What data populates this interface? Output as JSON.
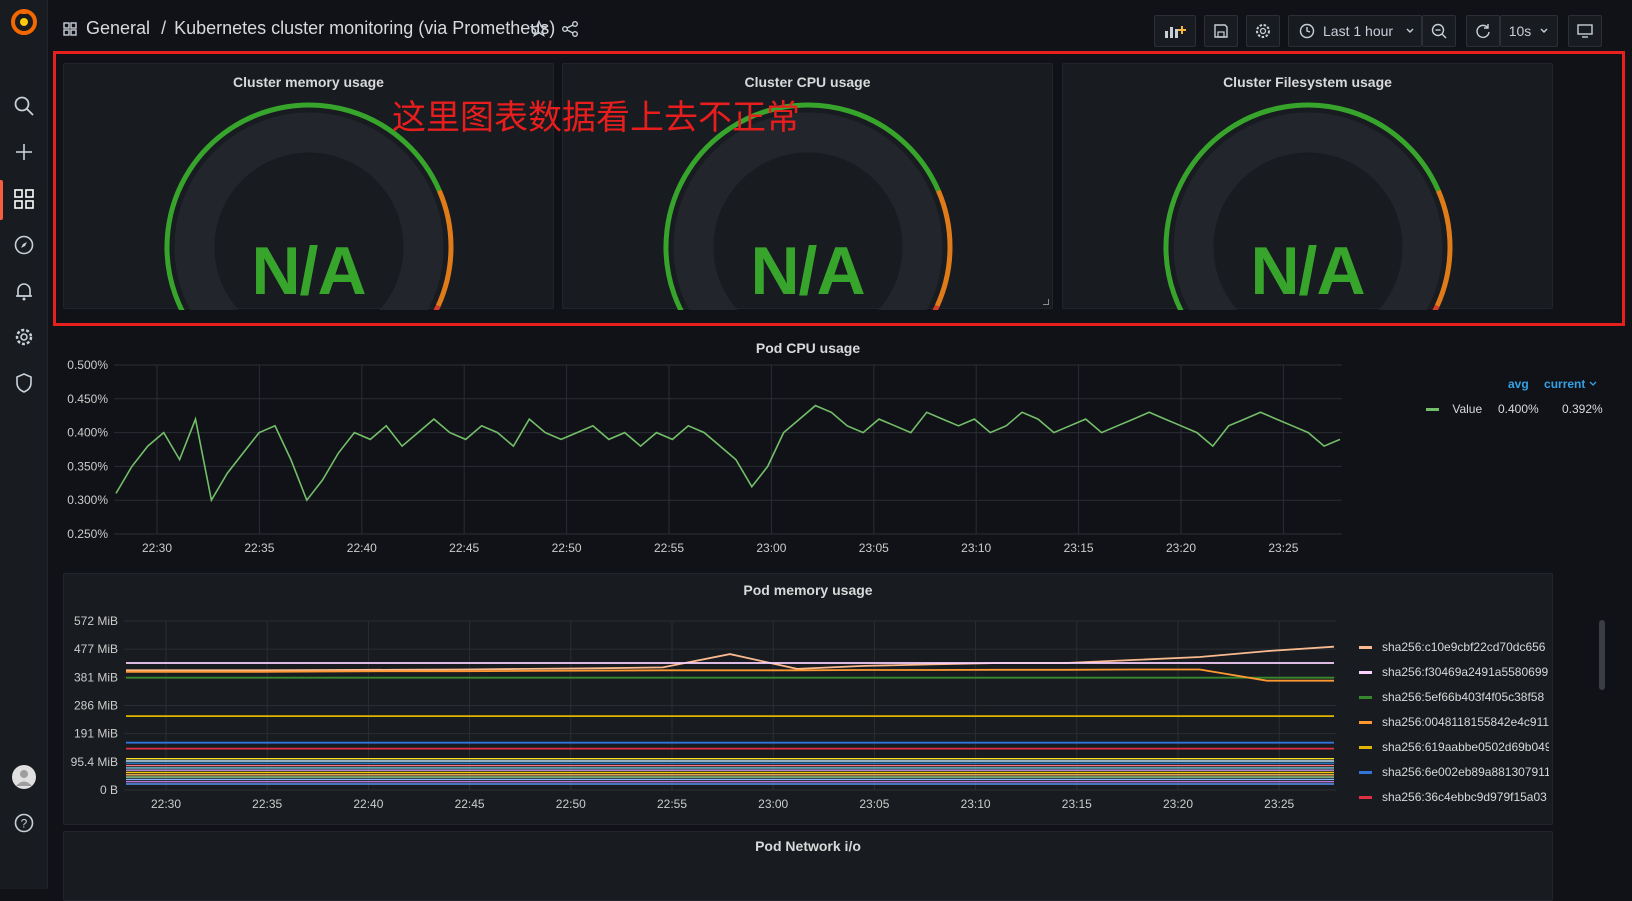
{
  "breadcrumb": {
    "folder": "General",
    "separator": "/",
    "title": "Kubernetes cluster monitoring (via Prometheus)"
  },
  "toolbar": {
    "time_range": "Last 1 hour",
    "refresh": "10s"
  },
  "gauges": [
    {
      "title": "Cluster memory usage",
      "value": "N/A"
    },
    {
      "title": "Cluster CPU usage",
      "value": "N/A"
    },
    {
      "title": "Cluster Filesystem usage",
      "value": "N/A"
    }
  ],
  "annotation": "这里图表数据看上去不正常",
  "cpu_panel": {
    "title": "Pod CPU usage",
    "legend_headers": {
      "avg": "avg",
      "current": "current"
    },
    "legend": [
      {
        "name": "Value",
        "avg": "0.400%",
        "current": "0.392%"
      }
    ]
  },
  "memory_panel": {
    "title": "Pod memory usage",
    "legend": [
      {
        "name": "sha256:c10e9cbf22cd70dc656",
        "color": "#f9ba8f"
      },
      {
        "name": "sha256:f30469a2491a5580699",
        "color": "#fbd2ff"
      },
      {
        "name": "sha256:5ef66b403f4f05c38f58",
        "color": "#37872d"
      },
      {
        "name": "sha256:0048118155842e4c911",
        "color": "#ff9830"
      },
      {
        "name": "sha256:619aabbe0502d69b049",
        "color": "#e0b400"
      },
      {
        "name": "sha256:6e002eb89a881307911",
        "color": "#3274d9"
      },
      {
        "name": "sha256:36c4ebbc9d979f15a03",
        "color": "#e02f44"
      }
    ]
  },
  "network_panel": {
    "title": "Pod Network i/o"
  },
  "chart_data": [
    {
      "type": "line",
      "title": "Pod CPU usage",
      "x_ticks": [
        "22:30",
        "22:35",
        "22:40",
        "22:45",
        "22:50",
        "22:55",
        "23:00",
        "23:05",
        "23:10",
        "23:15",
        "23:20",
        "23:25"
      ],
      "y_ticks": [
        "0.500%",
        "0.450%",
        "0.400%",
        "0.350%",
        "0.300%",
        "0.250%"
      ],
      "ylim": [
        0.25,
        0.5
      ],
      "series": [
        {
          "name": "Value",
          "color": "#73bf69",
          "values": [
            0.31,
            0.35,
            0.38,
            0.4,
            0.36,
            0.42,
            0.3,
            0.34,
            0.37,
            0.4,
            0.41,
            0.36,
            0.3,
            0.33,
            0.37,
            0.4,
            0.39,
            0.41,
            0.38,
            0.4,
            0.42,
            0.4,
            0.39,
            0.41,
            0.4,
            0.38,
            0.42,
            0.4,
            0.39,
            0.4,
            0.41,
            0.39,
            0.4,
            0.38,
            0.4,
            0.39,
            0.41,
            0.4,
            0.38,
            0.36,
            0.32,
            0.35,
            0.4,
            0.42,
            0.44,
            0.43,
            0.41,
            0.4,
            0.42,
            0.41,
            0.4,
            0.43,
            0.42,
            0.41,
            0.42,
            0.4,
            0.41,
            0.43,
            0.42,
            0.4,
            0.41,
            0.42,
            0.4,
            0.41,
            0.42,
            0.43,
            0.42,
            0.41,
            0.4,
            0.38,
            0.41,
            0.42,
            0.43,
            0.42,
            0.41,
            0.4,
            0.38,
            0.39
          ]
        }
      ]
    },
    {
      "type": "line",
      "title": "Pod memory usage",
      "x_ticks": [
        "22:30",
        "22:35",
        "22:40",
        "22:45",
        "22:50",
        "22:55",
        "23:00",
        "23:05",
        "23:10",
        "23:15",
        "23:20",
        "23:25"
      ],
      "y_ticks": [
        "572 MiB",
        "477 MiB",
        "381 MiB",
        "286 MiB",
        "191 MiB",
        "95.4 MiB",
        "0 B"
      ],
      "ylim": [
        0,
        572
      ],
      "series": [
        {
          "name": "sha256:c10e9cbf22cd70dc656",
          "color": "#f9ba8f",
          "values": [
            405,
            405,
            405,
            406,
            407,
            408,
            410,
            412,
            415,
            460,
            410,
            420,
            425,
            430,
            430,
            440,
            450,
            470,
            485
          ]
        },
        {
          "name": "sha256:f30469a2491a5580699",
          "color": "#fbd2ff",
          "values": [
            430,
            430,
            430,
            430,
            430,
            430,
            430,
            430,
            430,
            430,
            430,
            430,
            430,
            430,
            430,
            430,
            430,
            430,
            430
          ]
        },
        {
          "name": "sha256:5ef66b403f4f05c38f58",
          "color": "#37872d",
          "values": [
            380,
            380,
            380,
            380,
            380,
            380,
            380,
            380,
            380,
            380,
            380,
            380,
            380,
            380,
            380,
            380,
            380,
            380,
            380
          ]
        },
        {
          "name": "sha256:0048118155842e4c911",
          "color": "#ff9830",
          "values": [
            400,
            400,
            400,
            401,
            402,
            402,
            403,
            404,
            405,
            405,
            405,
            406,
            406,
            407,
            407,
            408,
            408,
            370,
            370
          ]
        },
        {
          "name": "sha256:619aabbe0502d69b049",
          "color": "#e0b400",
          "values": [
            250,
            250,
            250,
            250,
            250,
            250,
            250,
            250,
            250,
            250,
            250,
            250,
            250,
            250,
            250,
            250,
            250,
            250,
            250
          ]
        },
        {
          "name": "sha256:6e002eb89a881307911",
          "color": "#3274d9",
          "values": [
            160,
            160,
            160,
            160,
            160,
            160,
            160,
            160,
            160,
            160,
            160,
            160,
            160,
            160,
            160,
            160,
            160,
            160,
            160
          ]
        },
        {
          "name": "sha256:36c4ebbc9d979f15a03",
          "color": "#e02f44",
          "values": [
            140,
            140,
            140,
            140,
            140,
            140,
            140,
            140,
            140,
            140,
            140,
            140,
            140,
            140,
            140,
            140,
            140,
            140,
            140
          ]
        }
      ]
    }
  ]
}
